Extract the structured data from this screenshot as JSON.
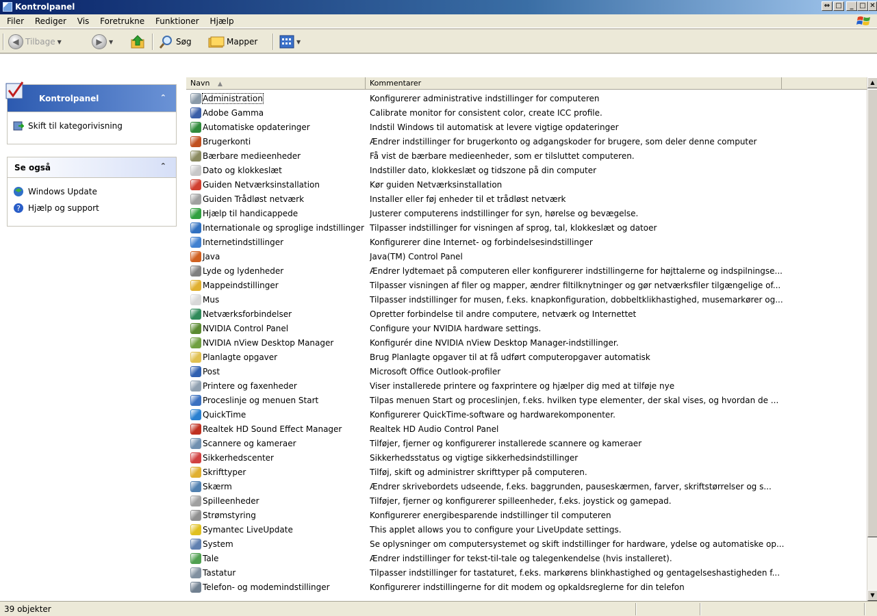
{
  "window": {
    "title": "Kontrolpanel"
  },
  "menu": [
    "Filer",
    "Rediger",
    "Vis",
    "Foretrukne",
    "Funktioner",
    "Hjælp"
  ],
  "toolbar": {
    "back_label": "Tilbage",
    "search_label": "Søg",
    "folders_label": "Mapper"
  },
  "sidebar": {
    "panel1": {
      "title": "Kontrolpanel",
      "item": "Skift til kategorivisning"
    },
    "panel2": {
      "title": "Se også",
      "items": [
        "Windows Update",
        "Hjælp og support"
      ]
    }
  },
  "list": {
    "columns": {
      "name": "Navn",
      "comment": "Kommentarer"
    },
    "rows": [
      {
        "name": "Administration",
        "comment": "Konfigurerer administrative indstillinger for computeren",
        "color": "#8a9aa8"
      },
      {
        "name": "Adobe Gamma",
        "comment": "Calibrate monitor for consistent color, create ICC profile.",
        "color": "#3a5ea8"
      },
      {
        "name": "Automatiske opdateringer",
        "comment": "Indstil Windows til automatisk at levere vigtige opdateringer",
        "color": "#2f8a3a"
      },
      {
        "name": "Brugerkonti",
        "comment": "Ændrer indstillinger for brugerkonto og adgangskoder for brugere, som deler denne computer",
        "color": "#c05020"
      },
      {
        "name": "Bærbare medieenheder",
        "comment": "Få vist de bærbare medieenheder, som er tilsluttet computeren.",
        "color": "#8a8a60"
      },
      {
        "name": "Dato og klokkeslæt",
        "comment": "Indstiller dato, klokkeslæt og tidszone på din computer",
        "color": "#c8c8c8"
      },
      {
        "name": "Guiden Netværksinstallation",
        "comment": "Kør guiden Netværksinstallation",
        "color": "#d04030"
      },
      {
        "name": "Guiden Trådløst netværk",
        "comment": "Installer eller føj enheder til et trådløst netværk",
        "color": "#a0a0a0"
      },
      {
        "name": "Hjælp til handicappede",
        "comment": "Justerer computerens indstillinger for syn, hørelse og bevægelse.",
        "color": "#30a040"
      },
      {
        "name": "Internationale og sproglige indstillinger",
        "comment": "Tilpasser indstillinger for visningen af sprog, tal, klokkeslæt og datoer",
        "color": "#3070c0"
      },
      {
        "name": "Internetindstillinger",
        "comment": "Konfigurerer dine Internet- og forbindelsesindstillinger",
        "color": "#4080d0"
      },
      {
        "name": "Java",
        "comment": "Java(TM) Control Panel",
        "color": "#d06020"
      },
      {
        "name": "Lyde og lydenheder",
        "comment": "Ændrer lydtemaet på computeren eller konfigurerer indstillingerne for højttalerne og indspilningse...",
        "color": "#808080"
      },
      {
        "name": "Mappeindstillinger",
        "comment": "Tilpasser visningen af filer og mapper, ændrer filtilknytninger og gør netværksfiler tilgængelige of...",
        "color": "#e0b030"
      },
      {
        "name": "Mus",
        "comment": "Tilpasser indstillinger for musen, f.eks. knapkonfiguration, dobbeltklikhastighed, musemarkører og...",
        "color": "#d8d8d8"
      },
      {
        "name": "Netværksforbindelser",
        "comment": "Opretter forbindelse til andre computere, netværk og Internettet",
        "color": "#2f8a5a"
      },
      {
        "name": "NVIDIA Control Panel",
        "comment": "Configure your NVIDIA hardware settings.",
        "color": "#5a8a30"
      },
      {
        "name": "NVIDIA nView Desktop Manager",
        "comment": "Konfigurér dine NVIDIA nView Desktop Manager-indstillinger.",
        "color": "#70a040"
      },
      {
        "name": "Planlagte opgaver",
        "comment": "Brug Planlagte opgaver til at få udført computeropgaver automatisk",
        "color": "#e0c050"
      },
      {
        "name": "Post",
        "comment": "Microsoft Office Outlook-profiler",
        "color": "#3060b0"
      },
      {
        "name": "Printere og faxenheder",
        "comment": "Viser installerede printere og faxprintere og hjælper dig med at tilføje nye",
        "color": "#90a0b0"
      },
      {
        "name": "Proceslinje og menuen Start",
        "comment": "Tilpas menuen Start og proceslinjen, f.eks. hvilken type elementer, der skal vises, og hvordan de ...",
        "color": "#3a70c0"
      },
      {
        "name": "QuickTime",
        "comment": "Konfigurerer QuickTime-software og hardwarekomponenter.",
        "color": "#2a80d0"
      },
      {
        "name": "Realtek HD Sound Effect Manager",
        "comment": "Realtek HD Audio Control Panel",
        "color": "#c03020"
      },
      {
        "name": "Scannere og kameraer",
        "comment": "Tilføjer, fjerner og konfigurerer installerede scannere og kameraer",
        "color": "#7090b0"
      },
      {
        "name": "Sikkerhedscenter",
        "comment": "Sikkerhedsstatus og vigtige sikkerhedsindstillinger",
        "color": "#d04040"
      },
      {
        "name": "Skrifttyper",
        "comment": "Tilføj, skift og administrer skrifttyper på computeren.",
        "color": "#e0b030"
      },
      {
        "name": "Skærm",
        "comment": "Ændrer skrivebordets udseende, f.eks. baggrunden, pauseskærmen, farver, skriftstørrelser og s...",
        "color": "#5080b0"
      },
      {
        "name": "Spilleenheder",
        "comment": "Tilføjer, fjerner og konfigurerer spilleenheder, f.eks. joystick og gamepad.",
        "color": "#a0a0a0"
      },
      {
        "name": "Strømstyring",
        "comment": "Konfigurerer energibesparende indstillinger til computeren",
        "color": "#909090"
      },
      {
        "name": "Symantec LiveUpdate",
        "comment": "This applet allows you to configure your LiveUpdate settings.",
        "color": "#e0c020"
      },
      {
        "name": "System",
        "comment": "Se oplysninger om computersystemet og skift indstillinger for hardware, ydelse og automatiske op...",
        "color": "#6080b0"
      },
      {
        "name": "Tale",
        "comment": "Ændrer indstillinger for tekst-til-tale og talegenkendelse (hvis installeret).",
        "color": "#50a050"
      },
      {
        "name": "Tastatur",
        "comment": "Tilpasser indstillinger for tastaturet, f.eks. markørens blinkhastighed og gentagelseshastigheden f...",
        "color": "#8090a0"
      },
      {
        "name": "Telefon- og modemindstillinger",
        "comment": "Konfigurerer indstillingerne for dit modem og opkaldsreglerne for din telefon",
        "color": "#708090"
      }
    ]
  },
  "status": {
    "text": "39 objekter"
  }
}
